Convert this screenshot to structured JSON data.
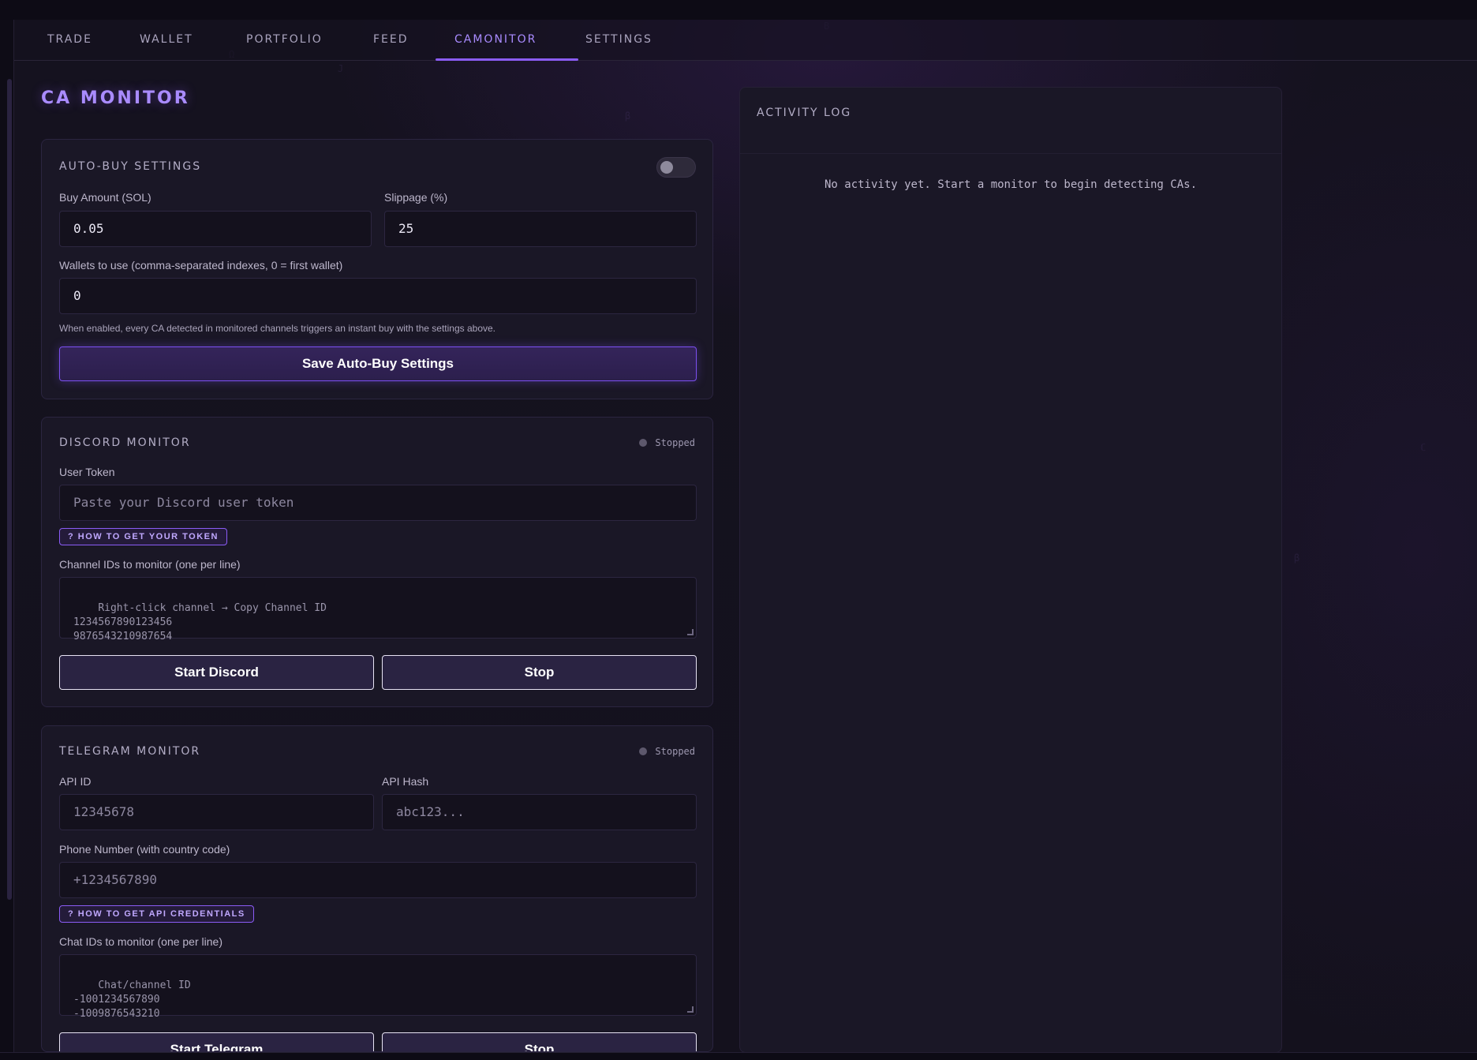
{
  "nav": {
    "tabs": [
      {
        "label": "TRADE"
      },
      {
        "label": "WALLET"
      },
      {
        "label": "PORTFOLIO"
      },
      {
        "label": "FEED"
      },
      {
        "label": "CAMONITOR"
      },
      {
        "label": "SETTINGS"
      }
    ],
    "active": "CAMONITOR"
  },
  "page": {
    "title": "CA MONITOR"
  },
  "autobuy": {
    "title": "AUTO-BUY SETTINGS",
    "enabled": false,
    "buy_amount_label": "Buy Amount (SOL)",
    "buy_amount_value": "0.05",
    "slippage_label": "Slippage (%)",
    "slippage_value": "25",
    "wallets_label": "Wallets to use (comma-separated indexes, 0 = first wallet)",
    "wallets_value": "0",
    "hint": "When enabled, every CA detected in monitored channels triggers an instant buy with the settings above.",
    "save_label": "Save Auto-Buy Settings"
  },
  "discord": {
    "title": "DISCORD MONITOR",
    "status": "Stopped",
    "token_label": "User Token",
    "token_placeholder": "Paste your Discord user token",
    "help_label": "? HOW TO GET YOUR TOKEN",
    "channels_label": "Channel IDs to monitor (one per line)",
    "channels_placeholder": "Right-click channel → Copy Channel ID\n1234567890123456\n9876543210987654",
    "start_label": "Start Discord",
    "stop_label": "Stop"
  },
  "telegram": {
    "title": "TELEGRAM MONITOR",
    "status": "Stopped",
    "api_id_label": "API ID",
    "api_id_placeholder": "12345678",
    "api_hash_label": "API Hash",
    "api_hash_placeholder": "abc123...",
    "phone_label": "Phone Number (with country code)",
    "phone_placeholder": "+1234567890",
    "help_label": "? HOW TO GET API CREDENTIALS",
    "chats_label": "Chat IDs to monitor (one per line)",
    "chats_placeholder": "Chat/channel ID\n-1001234567890\n-1009876543210",
    "start_label": "Start Telegram",
    "stop_label": "Stop"
  },
  "activity_log": {
    "title": "ACTIVITY LOG",
    "empty_text": "No activity yet. Start a monitor to begin detecting CAs."
  },
  "colors": {
    "accent": "#8b5cf6",
    "accent_text": "#a98bff",
    "background": "#14111d",
    "card": "#1a1726",
    "status_stopped": "#5d586c"
  }
}
